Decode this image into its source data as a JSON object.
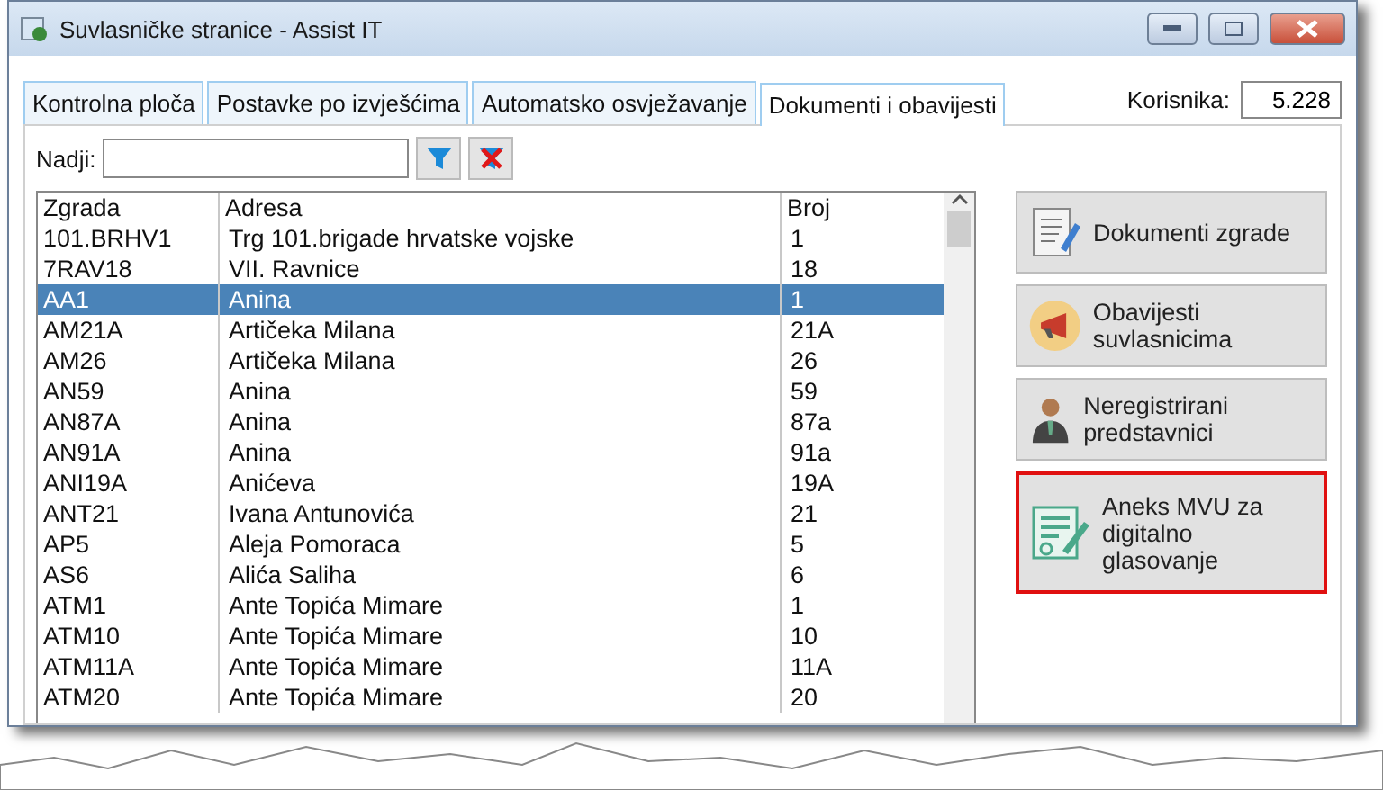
{
  "window": {
    "title": "Suvlasničke stranice - Assist IT"
  },
  "tabs": [
    {
      "label": "Kontrolna ploča",
      "selected": false
    },
    {
      "label": "Postavke po izvješćima",
      "selected": false
    },
    {
      "label": "Automatsko osvježavanje",
      "selected": false
    },
    {
      "label": "Dokumenti i obavijesti",
      "selected": true
    }
  ],
  "users": {
    "label": "Korisnika:",
    "value": "5.228"
  },
  "search": {
    "label": "Nadji:"
  },
  "table": {
    "columns": [
      "Zgrada",
      "Adresa",
      "Broj"
    ],
    "rows": [
      {
        "cells": [
          "101.BRHV1",
          "Trg 101.brigade hrvatske vojske",
          "1"
        ],
        "selected": false
      },
      {
        "cells": [
          "7RAV18",
          "VII. Ravnice",
          "18"
        ],
        "selected": false
      },
      {
        "cells": [
          "AA1",
          "Anina",
          "1"
        ],
        "selected": true
      },
      {
        "cells": [
          "AM21A",
          "Artičeka Milana",
          "21A"
        ],
        "selected": false
      },
      {
        "cells": [
          "AM26",
          "Artičeka Milana",
          "26"
        ],
        "selected": false
      },
      {
        "cells": [
          "AN59",
          "Anina",
          "59"
        ],
        "selected": false
      },
      {
        "cells": [
          "AN87A",
          "Anina",
          "87a"
        ],
        "selected": false
      },
      {
        "cells": [
          "AN91A",
          "Anina",
          "91a"
        ],
        "selected": false
      },
      {
        "cells": [
          "ANI19A",
          "Anićeva",
          "19A"
        ],
        "selected": false
      },
      {
        "cells": [
          "ANT21",
          "Ivana Antunovića",
          "21"
        ],
        "selected": false
      },
      {
        "cells": [
          "AP5",
          "Aleja Pomoraca",
          "5"
        ],
        "selected": false
      },
      {
        "cells": [
          "AS6",
          "Alića Saliha",
          "6"
        ],
        "selected": false
      },
      {
        "cells": [
          "ATM1",
          "Ante Topića Mimare",
          "1"
        ],
        "selected": false
      },
      {
        "cells": [
          "ATM10",
          "Ante Topića Mimare",
          "10"
        ],
        "selected": false
      },
      {
        "cells": [
          "ATM11A",
          "Ante Topića Mimare",
          "11A"
        ],
        "selected": false
      },
      {
        "cells": [
          "ATM20",
          "Ante Topića Mimare",
          "20"
        ],
        "selected": false
      }
    ]
  },
  "actions": [
    {
      "kind": "documents",
      "label": "Dokumenti zgrade",
      "highlighted": false
    },
    {
      "kind": "megaphone",
      "label": "Obavijesti suvlasnicima",
      "highlighted": false
    },
    {
      "kind": "person",
      "label": "Neregistrirani predstavnici",
      "highlighted": false
    },
    {
      "kind": "contract",
      "label": "Aneks MVU za digitalno glasovanje",
      "highlighted": true
    }
  ]
}
